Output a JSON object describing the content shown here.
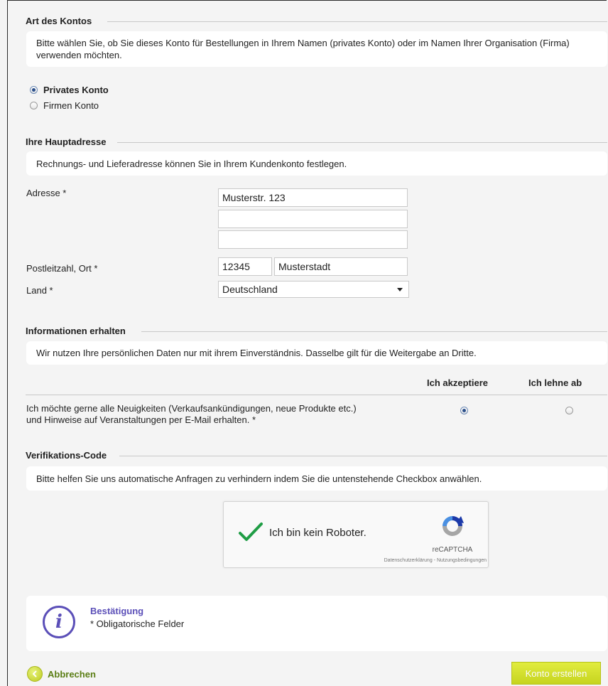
{
  "account_type": {
    "title": "Art des Kontos",
    "info": "Bitte wählen Sie, ob Sie dieses Konto für Bestellungen in Ihrem Namen (privates Konto) oder im Namen Ihrer Organisation (Firma) verwenden möchten.",
    "options": [
      {
        "label": "Privates Konto",
        "selected": true
      },
      {
        "label": "Firmen Konto",
        "selected": false
      }
    ]
  },
  "main_address": {
    "title": "Ihre Hauptadresse",
    "info": "Rechnungs- und Lieferadresse können Sie in Ihrem Kundenkonto festlegen.",
    "address_label": "Adresse *",
    "address_lines": [
      "Musterstr. 123",
      "",
      ""
    ],
    "zip_city_label": "Postleitzahl, Ort  *",
    "zip": "12345",
    "city": "Musterstadt",
    "country_label": "Land *",
    "country": "Deutschland"
  },
  "newsletter": {
    "title": "Informationen erhalten",
    "info": "Wir nutzen Ihre persönlichen Daten nur mit ihrem Einverständnis. Dasselbe gilt für die Weitergabe an Dritte.",
    "accept_header": "Ich akzeptiere",
    "decline_header": "Ich lehne ab",
    "question_line1": "Ich möchte gerne alle Neuigkeiten (Verkaufsankündigungen, neue Produkte etc.)",
    "question_line2": "und Hinweise auf Veranstaltungen per E-Mail erhalten. *",
    "choice": "accept"
  },
  "verification": {
    "title": "Verifikations-Code",
    "info": "Bitte helfen Sie uns automatische Anfragen zu verhindern indem Sie die untenstehende Checkbox anwählen.",
    "captcha_label": "Ich bin kein Roboter.",
    "captcha_brand": "reCAPTCHA",
    "captcha_links": "Datenschutzerklärung - Nutzungsbedingungen"
  },
  "confirmation": {
    "title": "Bestätigung",
    "text": "* Obligatorische Felder"
  },
  "actions": {
    "cancel_label": "Abbrechen",
    "submit_label": "Konto erstellen"
  },
  "colors": {
    "accent_green": "#c6d420",
    "link_green": "#5a7d13",
    "info_purple": "#5b4fb8",
    "radio_selected": "#2b4f8a"
  }
}
